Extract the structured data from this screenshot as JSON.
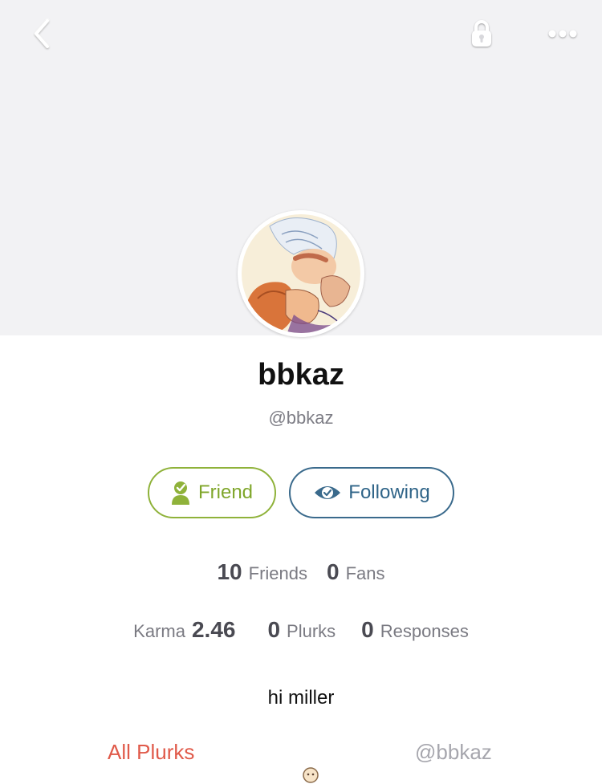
{
  "profile": {
    "display_name": "bbkaz",
    "handle": "@bbkaz",
    "about": "hi miller"
  },
  "actions": {
    "friend_label": "Friend",
    "following_label": "Following"
  },
  "stats": {
    "friends": {
      "value": "10",
      "label": "Friends"
    },
    "fans": {
      "value": "0",
      "label": "Fans"
    },
    "karma": {
      "label": "Karma",
      "value": "2.46"
    },
    "plurks": {
      "value": "0",
      "label": "Plurks"
    },
    "responses": {
      "value": "0",
      "label": "Responses"
    }
  },
  "tabs": {
    "all_label": "All Plurks",
    "mentions_label": "@bbkaz"
  },
  "icons": {
    "back": "chevron-left-icon",
    "lock": "lock-icon",
    "more": "more-dots-icon",
    "friend": "person-check-icon",
    "following": "eye-check-icon"
  },
  "colors": {
    "header_bg": "#f2f2f4",
    "friend_accent": "#8fb23a",
    "following_accent": "#3a6a8c",
    "active_tab": "#e05a4a",
    "inactive_tab": "#a6a6ad"
  }
}
